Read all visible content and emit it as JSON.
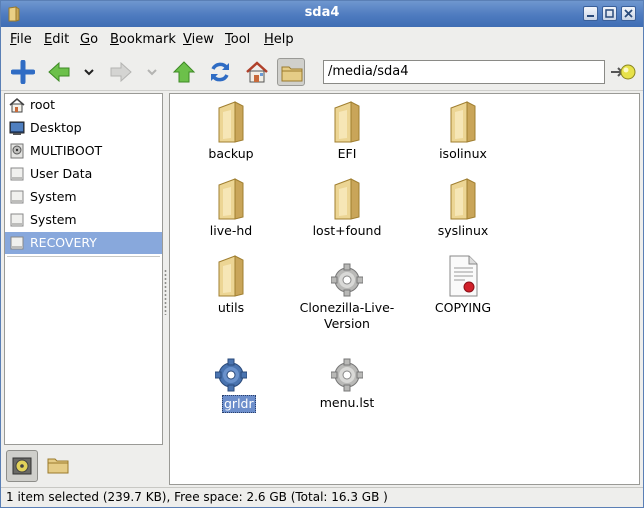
{
  "window": {
    "title": "sda4"
  },
  "menu": [
    {
      "label": "File",
      "mnemonic": "F",
      "rest": "ile"
    },
    {
      "label": "Edit",
      "mnemonic": "E",
      "rest": "dit"
    },
    {
      "label": "Go",
      "mnemonic": "G",
      "rest": "o"
    },
    {
      "label": "Bookmark",
      "mnemonic": "B",
      "rest": "ookmark"
    },
    {
      "label": "View",
      "mnemonic": "V",
      "rest": "iew"
    },
    {
      "label": "Tool",
      "mnemonic": "T",
      "rest": "ool"
    },
    {
      "label": "Help",
      "mnemonic": "H",
      "rest": "elp"
    }
  ],
  "toolbar": {
    "path": "/media/sda4"
  },
  "places": [
    {
      "label": "root",
      "icon": "home-icon"
    },
    {
      "label": "Desktop",
      "icon": "desktop-icon"
    },
    {
      "label": "MULTIBOOT",
      "icon": "drive-icon"
    },
    {
      "label": "User Data",
      "icon": "drive-icon"
    },
    {
      "label": "System",
      "icon": "drive-icon"
    },
    {
      "label": "System",
      "icon": "drive-icon"
    },
    {
      "label": "RECOVERY",
      "icon": "drive-icon",
      "selected": true
    }
  ],
  "files": [
    {
      "name": "backup",
      "type": "folder"
    },
    {
      "name": "EFI",
      "type": "folder"
    },
    {
      "name": "isolinux",
      "type": "folder"
    },
    {
      "name": "live-hd",
      "type": "folder"
    },
    {
      "name": "lost+found",
      "type": "folder"
    },
    {
      "name": "syslinux",
      "type": "folder"
    },
    {
      "name": "utils",
      "type": "folder"
    },
    {
      "name": "Clonezilla-Live-Version",
      "type": "gear",
      "line1": "Clonezilla-Live-",
      "line2": "Version"
    },
    {
      "name": "COPYING",
      "type": "document"
    },
    {
      "name": "grldr",
      "type": "gear-blue",
      "selected": true
    },
    {
      "name": "menu.lst",
      "type": "gear"
    }
  ],
  "status": {
    "text": "1 item selected (239.7 KB), Free space: 2.6 GB (Total: 16.3 GB )"
  },
  "colors": {
    "titlebar": "#4e7bbf",
    "selection": "#88a8dc",
    "folder": "#e8cf8c"
  }
}
